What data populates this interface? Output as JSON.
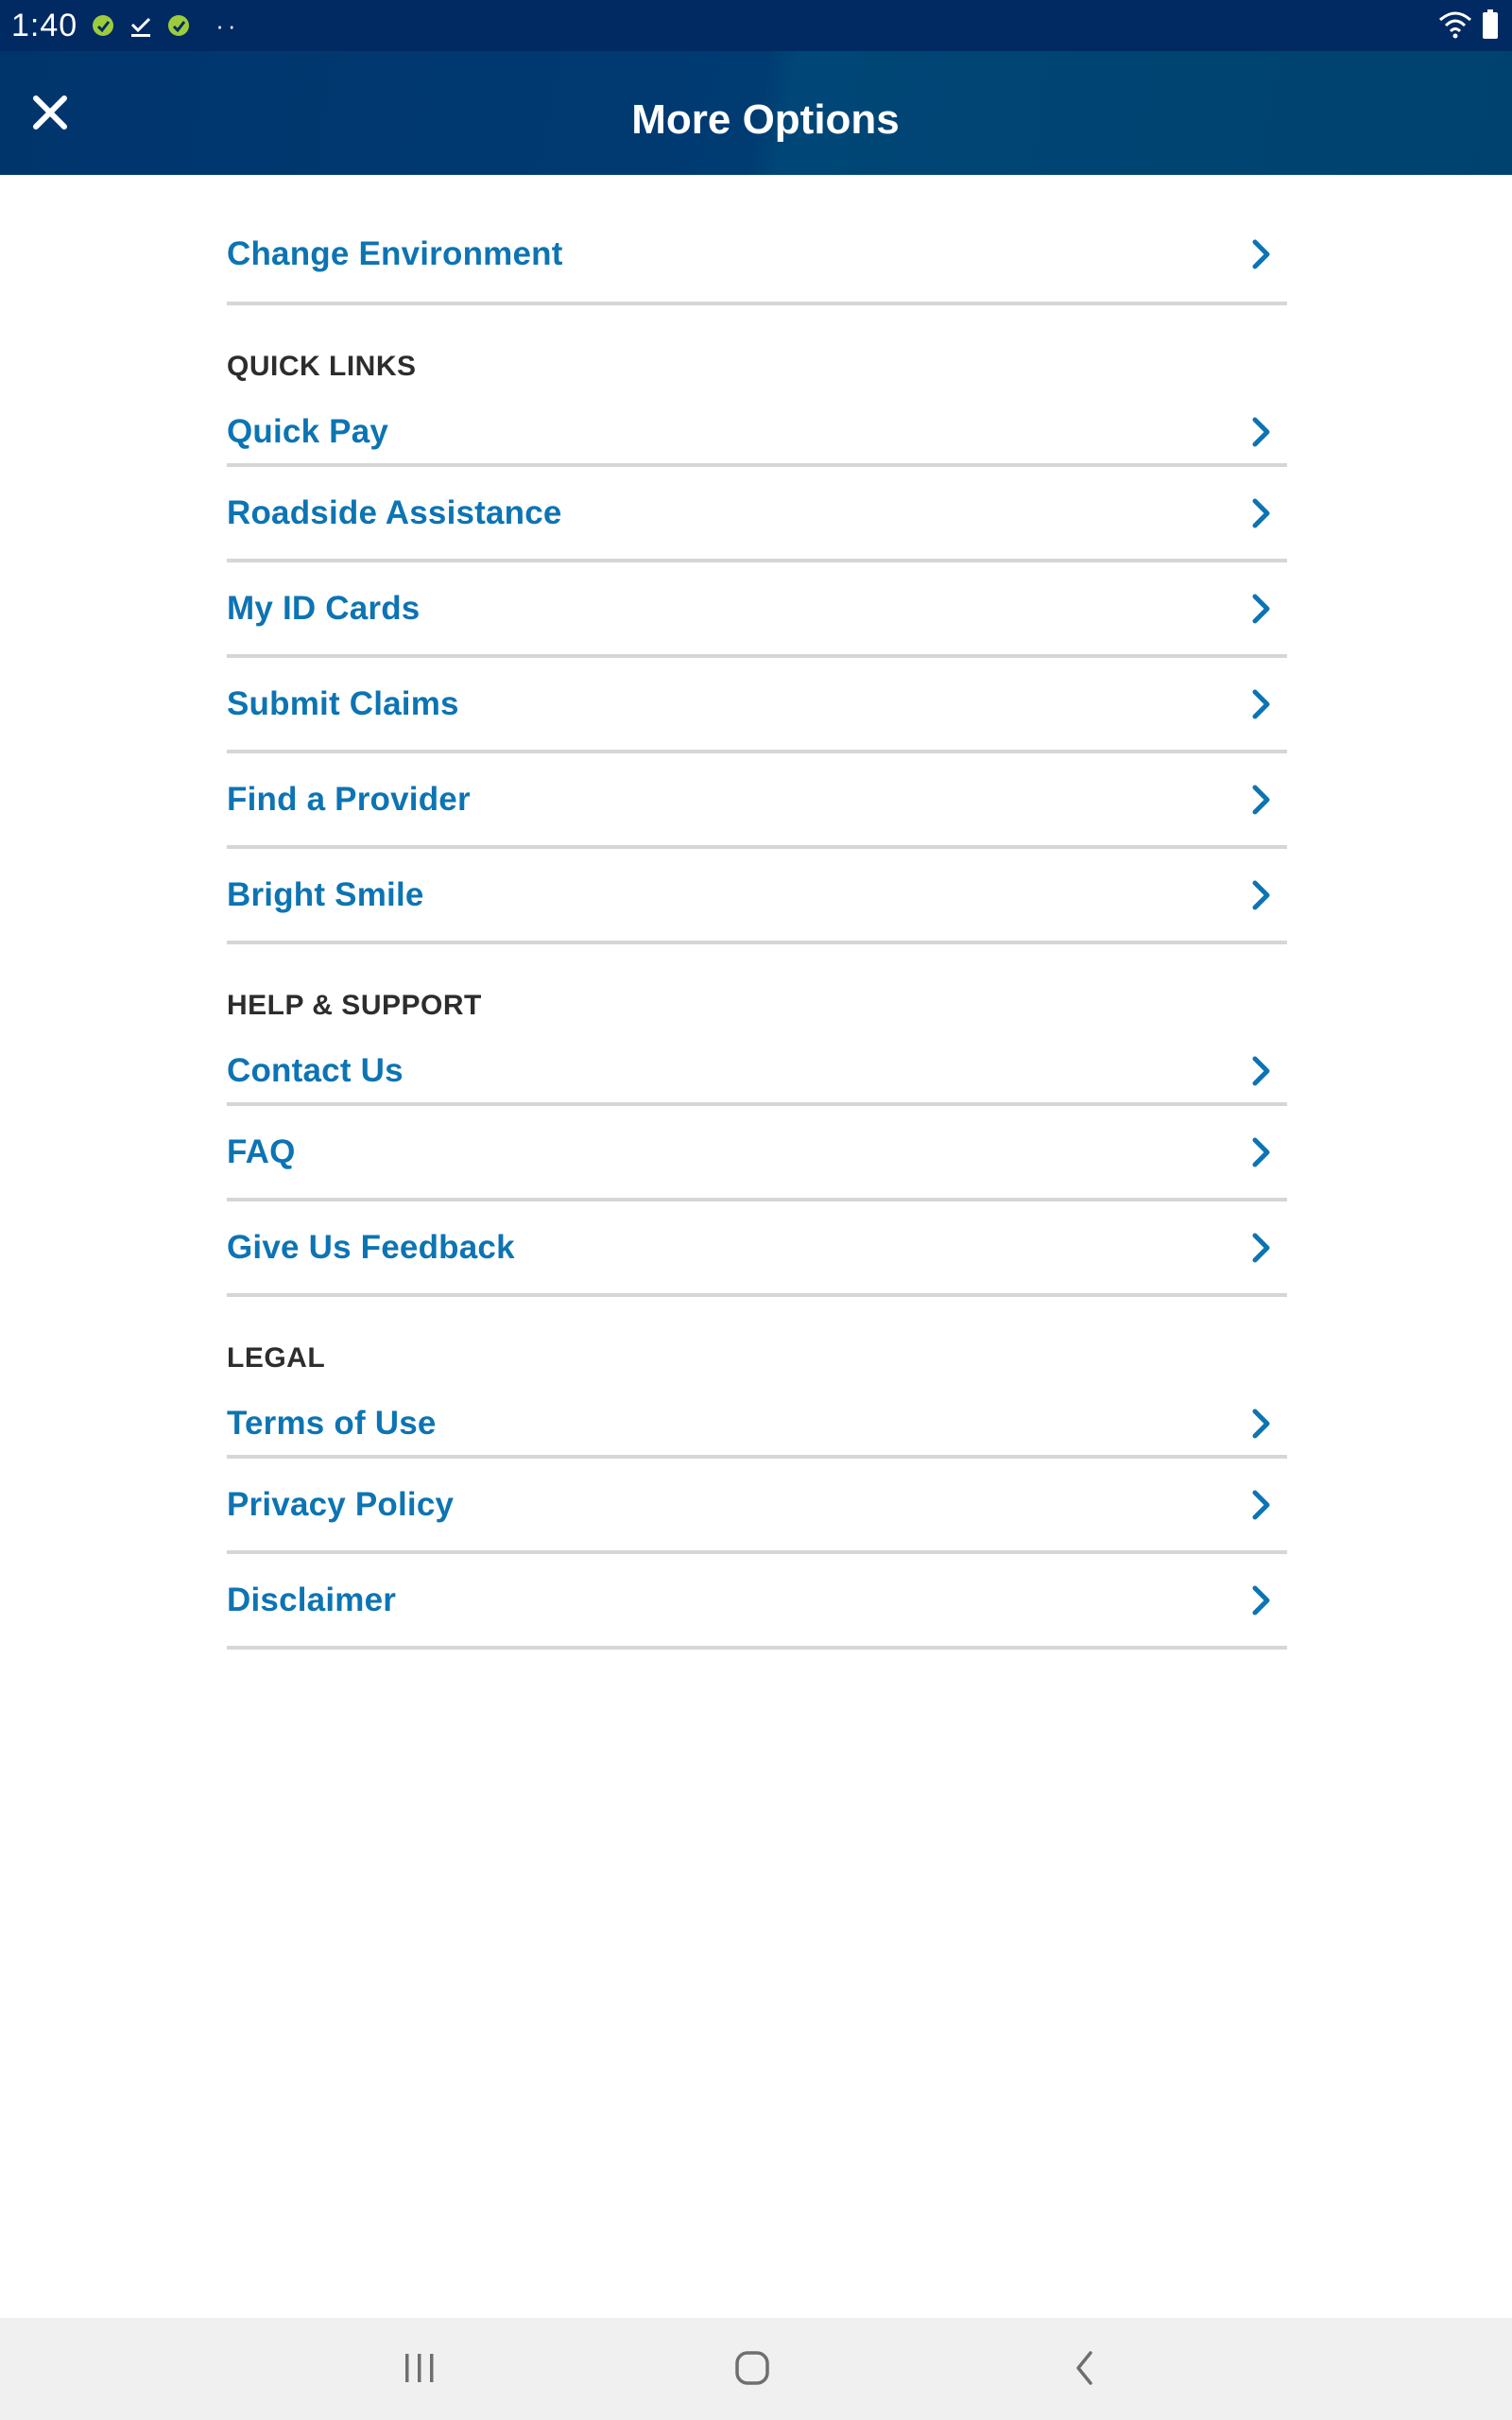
{
  "status_bar": {
    "time": "1:40",
    "dots": "··",
    "icons_left": [
      "green-shield-icon",
      "download-check-icon",
      "green-shield-icon"
    ],
    "icons_right": [
      "wifi-icon",
      "battery-icon"
    ]
  },
  "header": {
    "title": "More Options",
    "close_icon": "close-icon"
  },
  "top_item": {
    "label": "Change Environment"
  },
  "sections": [
    {
      "heading": "QUICK LINKS",
      "items": [
        {
          "label": "Quick Pay"
        },
        {
          "label": "Roadside Assistance"
        },
        {
          "label": "My ID Cards"
        },
        {
          "label": "Submit Claims"
        },
        {
          "label": "Find a Provider"
        },
        {
          "label": "Bright Smile"
        }
      ]
    },
    {
      "heading": "HELP & SUPPORT",
      "items": [
        {
          "label": "Contact Us"
        },
        {
          "label": "FAQ"
        },
        {
          "label": "Give Us Feedback"
        }
      ]
    },
    {
      "heading": "LEGAL",
      "items": [
        {
          "label": "Terms of Use"
        },
        {
          "label": "Privacy Policy"
        },
        {
          "label": "Disclaimer"
        }
      ]
    }
  ],
  "nav_bar": {
    "recents_icon": "recents-icon",
    "home_icon": "home-icon",
    "back_icon": "back-icon"
  },
  "colors": {
    "status_bar": "#012a63",
    "header": "#00426f",
    "link": "#0d74b3",
    "divider": "#d6d6d6",
    "heading_text": "#2d2d2d"
  }
}
